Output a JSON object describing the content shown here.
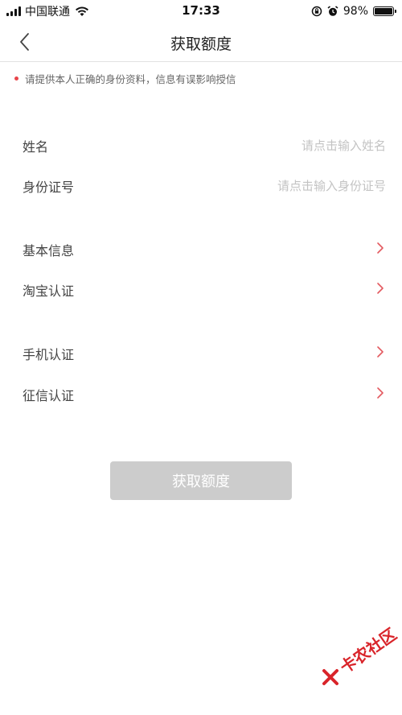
{
  "status_bar": {
    "carrier": "中国联通",
    "time": "17:33",
    "battery": "98%",
    "battery_level": 0.98
  },
  "nav": {
    "title": "获取额度"
  },
  "notice": {
    "text": "请提供本人正确的身份资料，信息有误影响授信",
    "color": "#e8454a"
  },
  "form": {
    "name_label": "姓名",
    "name_placeholder": "请点击输入姓名",
    "id_label": "身份证号",
    "id_placeholder": "请点击输入身份证号"
  },
  "items": [
    {
      "label": "基本信息"
    },
    {
      "label": "淘宝认证"
    },
    {
      "label": "手机认证"
    },
    {
      "label": "征信认证"
    }
  ],
  "submit_button": {
    "label": "获取额度",
    "bg": "#cccccc"
  },
  "watermark": {
    "text": "卡农社区",
    "color": "#d9242a"
  }
}
